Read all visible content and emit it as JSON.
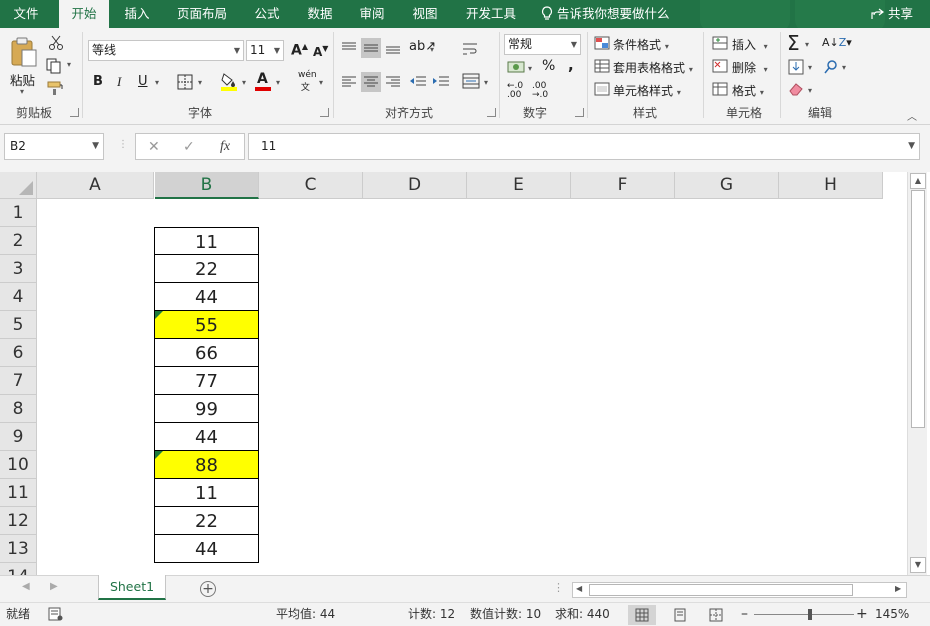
{
  "ribbon_tabs": [
    "文件",
    "开始",
    "插入",
    "页面布局",
    "公式",
    "数据",
    "审阅",
    "视图",
    "开发工具"
  ],
  "active_tab": "开始",
  "tell_me": "告诉我你想要做什么",
  "share": "共享",
  "clipboard": {
    "paste": "粘贴",
    "group": "剪贴板"
  },
  "font": {
    "name": "等线",
    "size": "11",
    "group": "字体",
    "bold": "B",
    "italic": "I",
    "underline": "U",
    "phonetic": "wén"
  },
  "alignment": {
    "group": "对齐方式"
  },
  "number": {
    "format": "常规",
    "percent": "%",
    "comma": ",",
    "group": "数字"
  },
  "styles": {
    "conditional": "条件格式",
    "table": "套用表格格式",
    "cell": "单元格样式",
    "group": "样式"
  },
  "cells": {
    "insert": "插入",
    "delete": "删除",
    "format": "格式",
    "group": "单元格"
  },
  "editing": {
    "group": "编辑"
  },
  "namebox": "B2",
  "formula": "11",
  "columns": [
    "A",
    "B",
    "C",
    "D",
    "E",
    "F",
    "G",
    "H"
  ],
  "rows": [
    "1",
    "2",
    "3",
    "4",
    "5",
    "6",
    "7",
    "8",
    "9",
    "10",
    "11",
    "12",
    "13",
    "14"
  ],
  "b_values": [
    "11",
    "22",
    "44",
    "55",
    "66",
    "77",
    "99",
    "44",
    "88",
    "11",
    "22",
    "44"
  ],
  "highlighted": [
    "55",
    "88"
  ],
  "highlight_color": "#ffff00",
  "sheet_tab": "Sheet1",
  "status": {
    "ready": "就绪",
    "average": "平均值: 44",
    "count": "计数: 12",
    "numcount": "数值计数: 10",
    "sum": "求和: 440",
    "zoom": "145%"
  },
  "accent_color": "#217346"
}
